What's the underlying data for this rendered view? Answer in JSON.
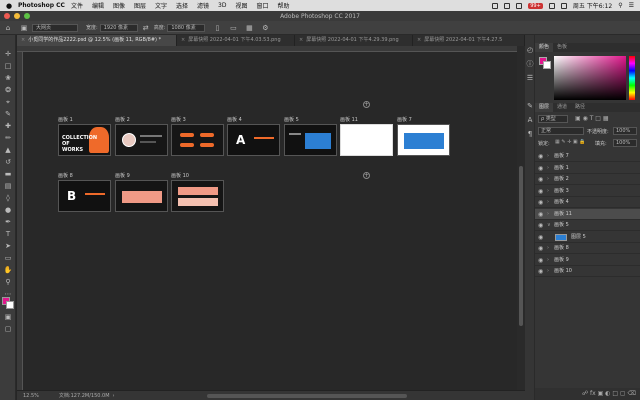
{
  "menubar": {
    "apple": "",
    "app": "Photoshop CC",
    "items": [
      "文件",
      "编辑",
      "图像",
      "图层",
      "文字",
      "选择",
      "滤镜",
      "3D",
      "视图",
      "窗口",
      "帮助"
    ],
    "battery": "99+",
    "clock": "周五 下午6:12"
  },
  "window": {
    "title": "Adobe Photoshop CC 2017"
  },
  "options": {
    "size_preset": "大网页",
    "width_label": "宽度:",
    "width_value": "1920 像素",
    "height_label": "高度:",
    "height_value": "1080 像素"
  },
  "tabs": [
    {
      "label": "小觅同学的作品2222.psd @ 12.5% (画板 11, RGB/8#) *",
      "active": true
    },
    {
      "label": "屏幕快照 2022-04-01 下午4.03.53.png",
      "active": false
    },
    {
      "label": "屏幕快照 2022-04-01 下午4.29.39.png",
      "active": false
    },
    {
      "label": "屏幕快照 2022-04-01 下午4.27.5",
      "active": false
    }
  ],
  "artboards": [
    {
      "label": "画板 1",
      "text": "COLLECTION OF WORKS"
    },
    {
      "label": "画板 2",
      "text": ""
    },
    {
      "label": "画板 3",
      "text": ""
    },
    {
      "label": "画板 4",
      "text": "A"
    },
    {
      "label": "画板 5",
      "text": ""
    },
    {
      "label": "画板 11",
      "text": ""
    },
    {
      "label": "画板 7",
      "text": ""
    },
    {
      "label": "画板 8",
      "text": "B"
    },
    {
      "label": "画板 9",
      "text": ""
    },
    {
      "label": "画板 10",
      "text": ""
    }
  ],
  "status": {
    "zoom": "12.5%",
    "doc": "文档:127.2M/150.0M"
  },
  "panels": {
    "color_tabs": [
      "颜色",
      "色板"
    ],
    "layer_tabs": [
      "图层",
      "通道",
      "路径"
    ],
    "filter": "ρ 类型",
    "blend": "正常",
    "opacity_label": "不透明度:",
    "opacity_value": "100%",
    "lock_label": "锁定:",
    "fill_label": "填充:",
    "fill_value": "100%"
  },
  "layers": [
    {
      "name": "画板 7",
      "expanded": false,
      "selected": false,
      "child": false
    },
    {
      "name": "画板 1",
      "expanded": false,
      "selected": false,
      "child": false
    },
    {
      "name": "画板 2",
      "expanded": false,
      "selected": false,
      "child": false
    },
    {
      "name": "画板 3",
      "expanded": false,
      "selected": false,
      "child": false
    },
    {
      "name": "画板 4",
      "expanded": false,
      "selected": false,
      "child": false
    },
    {
      "name": "画板 11",
      "expanded": false,
      "selected": true,
      "child": false
    },
    {
      "name": "画板 5",
      "expanded": true,
      "selected": false,
      "child": false
    },
    {
      "name": "图层 5",
      "expanded": false,
      "selected": false,
      "child": true
    },
    {
      "name": "画板 8",
      "expanded": false,
      "selected": false,
      "child": false
    },
    {
      "name": "画板 9",
      "expanded": false,
      "selected": false,
      "child": false
    },
    {
      "name": "画板 10",
      "expanded": false,
      "selected": false,
      "child": false
    }
  ],
  "colors": {
    "foreground": "#e0178c",
    "background": "#ffffff",
    "accent": "#e0178c"
  }
}
